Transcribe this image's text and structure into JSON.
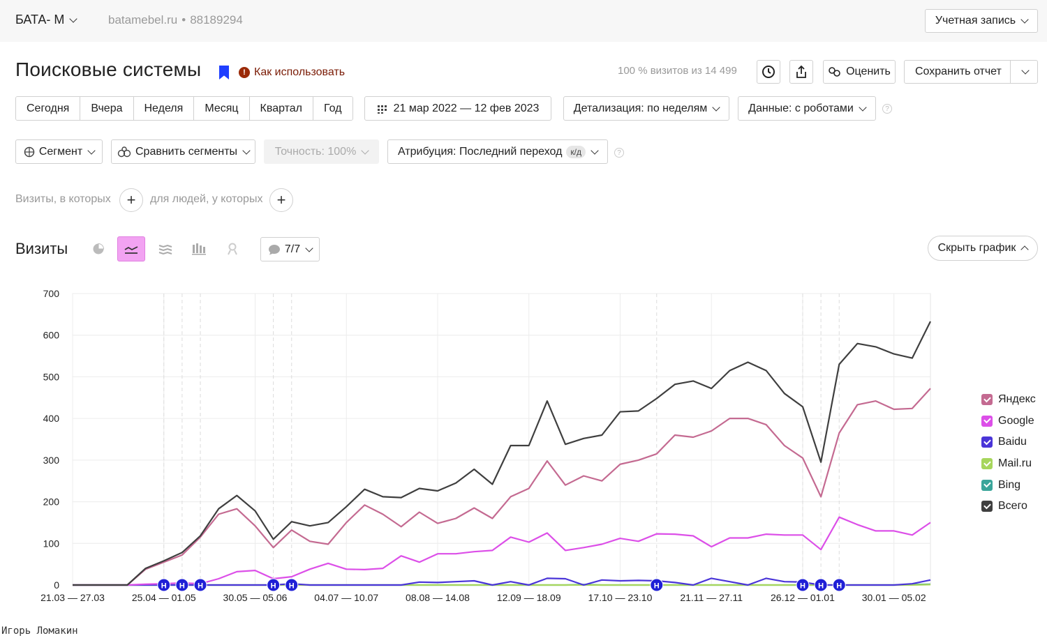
{
  "topbar": {
    "counter_name": "БАТА- М",
    "site_host": "batamebel.ru",
    "counter_id": "88189294",
    "account_label": "Учетная запись"
  },
  "header": {
    "title": "Поисковые системы",
    "howto_label": "Как использовать",
    "visits_share": "100 % визитов из 14 499",
    "rate_label": "Оценить",
    "save_label": "Сохранить отчет"
  },
  "periods": [
    "Сегодня",
    "Вчера",
    "Неделя",
    "Месяц",
    "Квартал",
    "Год"
  ],
  "date_range": "21 мар 2022 — 12 фев 2023",
  "detail_label": "Детализация: по неделям",
  "data_label": "Данные: с роботами",
  "segment_label": "Сегмент",
  "compare_label": "Сравнить сегменты",
  "accuracy_label": "Точность: 100%",
  "attribution_label": "Атрибуция: Последний переход",
  "attribution_badge": "к/д",
  "filters": {
    "visits_label": "Визиты, в которых",
    "people_label": "для людей, у которых"
  },
  "chart_section": {
    "title": "Визиты",
    "series_counter": "7/7",
    "hide_label": "Скрыть график"
  },
  "chart_data": {
    "type": "line",
    "ylim": [
      0,
      700
    ],
    "yticks": [
      0,
      100,
      200,
      300,
      400,
      500,
      600,
      700
    ],
    "xtick_labels": [
      "21.03 — 27.03",
      "25.04 — 01.05",
      "30.05 — 05.06",
      "04.07 — 10.07",
      "08.08 — 14.08",
      "12.09 — 18.09",
      "17.10 — 23.10",
      "21.11 — 27.11",
      "26.12 — 01.01",
      "30.01 — 05.02"
    ],
    "xtick_index": [
      0,
      5,
      10,
      15,
      20,
      25,
      30,
      35,
      40,
      45
    ],
    "holiday_marker_label": "Н",
    "holiday_week_index": [
      5,
      6,
      7,
      11,
      12,
      32,
      40,
      41,
      42
    ],
    "series": [
      {
        "name": "Всего",
        "color": "#3f3f3f",
        "values": [
          0,
          0,
          0,
          0,
          40,
          58,
          78,
          118,
          183,
          215,
          178,
          110,
          152,
          142,
          150,
          188,
          230,
          212,
          210,
          232,
          226,
          245,
          278,
          242,
          335,
          335,
          442,
          338,
          352,
          360,
          416,
          418,
          448,
          482,
          490,
          472,
          515,
          535,
          515,
          460,
          428,
          295,
          530,
          580,
          572,
          555,
          545,
          633
        ]
      },
      {
        "name": "Яндекс",
        "color": "#c46a91",
        "values": [
          0,
          0,
          0,
          0,
          38,
          55,
          72,
          115,
          170,
          183,
          142,
          90,
          132,
          105,
          98,
          150,
          192,
          170,
          140,
          175,
          148,
          160,
          185,
          160,
          212,
          232,
          298,
          240,
          262,
          250,
          290,
          300,
          315,
          360,
          355,
          370,
          400,
          400,
          385,
          335,
          305,
          212,
          365,
          433,
          442,
          422,
          424,
          472
        ]
      },
      {
        "name": "Google",
        "color": "#dc4fe8",
        "values": [
          0,
          0,
          0,
          0,
          2,
          3,
          5,
          3,
          15,
          32,
          35,
          15,
          20,
          38,
          52,
          38,
          37,
          40,
          70,
          55,
          75,
          75,
          80,
          83,
          115,
          103,
          125,
          83,
          90,
          98,
          112,
          105,
          123,
          122,
          118,
          92,
          113,
          113,
          122,
          120,
          120,
          85,
          163,
          145,
          130,
          130,
          120,
          150
        ]
      },
      {
        "name": "Baidu",
        "color": "#4a35d8",
        "values": [
          0,
          0,
          0,
          0,
          0,
          0,
          0,
          0,
          0,
          0,
          0,
          0,
          3,
          0,
          0,
          0,
          0,
          0,
          0,
          7,
          6,
          8,
          10,
          0,
          8,
          0,
          16,
          15,
          0,
          12,
          10,
          11,
          10,
          6,
          0,
          16,
          8,
          0,
          16,
          8,
          7,
          0,
          0,
          0,
          0,
          0,
          3,
          12
        ]
      },
      {
        "name": "Mail.ru",
        "color": "#a7d65c",
        "values": [
          0,
          0,
          0,
          0,
          0,
          0,
          0,
          0,
          0,
          0,
          0,
          0,
          0,
          0,
          0,
          0,
          0,
          0,
          0,
          0,
          0,
          0,
          0,
          0,
          0,
          0,
          0,
          0,
          0,
          0,
          0,
          0,
          0,
          0,
          0,
          0,
          0,
          0,
          0,
          0,
          0,
          0,
          0,
          0,
          0,
          0,
          0,
          1
        ]
      },
      {
        "name": "Bing",
        "color": "#3aa59a",
        "values": [
          0,
          0,
          0,
          0,
          0,
          0,
          0,
          0,
          0,
          0,
          0,
          0,
          1,
          0,
          0,
          0,
          0,
          0,
          0,
          0,
          0,
          0,
          0,
          0,
          0,
          0,
          0,
          0,
          1,
          0,
          0,
          0,
          0,
          0,
          0,
          0,
          0,
          0,
          0,
          0,
          0,
          0,
          0,
          0,
          0,
          0,
          1,
          2
        ]
      }
    ]
  },
  "legend": [
    {
      "label": "Яндекс",
      "color": "#c46a91"
    },
    {
      "label": "Google",
      "color": "#dc4fe8"
    },
    {
      "label": "Baidu",
      "color": "#4a35d8"
    },
    {
      "label": "Mail.ru",
      "color": "#a7d65c"
    },
    {
      "label": "Bing",
      "color": "#3aa59a"
    },
    {
      "label": "Всего",
      "color": "#3f3f3f"
    }
  ],
  "watermark": "Игорь Ломакин"
}
